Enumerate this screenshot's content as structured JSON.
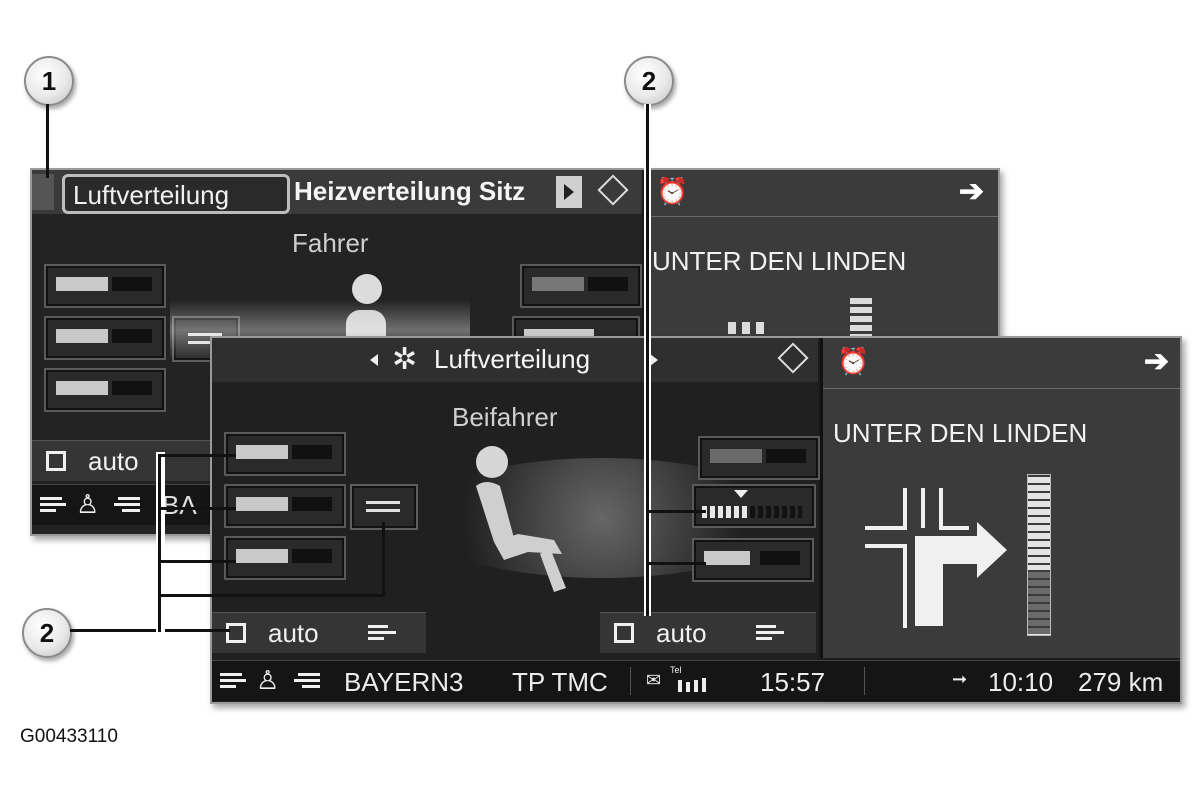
{
  "callouts": {
    "c1": "1",
    "c2_top": "2",
    "c2_left": "2"
  },
  "back_screen": {
    "tab_active": "Luftverteilung",
    "tab_next": "Heizverteilung Sitz",
    "seat_label": "Fahrer",
    "auto_label": "auto",
    "status_station_partial": "BA",
    "nav_street": "UNTER DEN LINDEN"
  },
  "front_screen": {
    "title": "Luftverteilung",
    "seat_label": "Beifahrer",
    "auto_left": "auto",
    "auto_right": "auto",
    "status": {
      "station": "BAYERN3",
      "tp": "TP TMC",
      "signal": "Tel",
      "clock": "15:57",
      "eta": "10:10",
      "distance": "279 km"
    },
    "nav_street": "UNTER DEN LINDEN"
  },
  "figure_id": "G00433110",
  "icons": [
    "alarm-clock-icon",
    "arrow-right-icon",
    "fan-icon",
    "joystick-icon",
    "seat-icon",
    "triangle-left-icon",
    "triangle-right-icon",
    "arrow-forward-icon",
    "mail-icon",
    "signal-bars-icon"
  ],
  "colors": {
    "screen_bg": "#1c1c1c",
    "panel": "#3b3b3b",
    "text": "#f2f2f2"
  }
}
